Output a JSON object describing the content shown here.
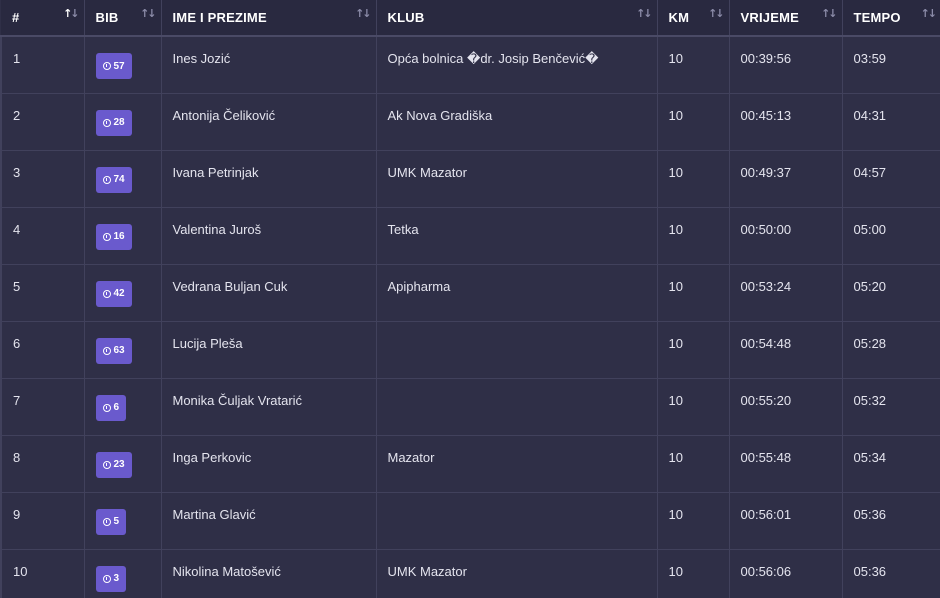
{
  "table": {
    "headers": [
      "#",
      "BIB",
      "IME I PREZIME",
      "KLUB",
      "KM",
      "VRIJEME",
      "TEMPO"
    ],
    "sort_icons": [
      "sort-asc-active-icon",
      "sort-icon",
      "sort-icon",
      "sort-icon",
      "sort-icon",
      "sort-icon",
      "sort-icon"
    ],
    "rows": [
      {
        "rank": "1",
        "bib": "57",
        "name": "Ines Jozić",
        "club": "Opća bolnica �dr. Josip Benčević�",
        "km": "10",
        "time": "00:39:56",
        "pace": "03:59"
      },
      {
        "rank": "2",
        "bib": "28",
        "name": "Antonija Čeliković",
        "club": "Ak Nova Gradiška",
        "km": "10",
        "time": "00:45:13",
        "pace": "04:31"
      },
      {
        "rank": "3",
        "bib": "74",
        "name": "Ivana Petrinjak",
        "club": "UMK Mazator",
        "km": "10",
        "time": "00:49:37",
        "pace": "04:57"
      },
      {
        "rank": "4",
        "bib": "16",
        "name": "Valentina Juroš",
        "club": "Tetka",
        "km": "10",
        "time": "00:50:00",
        "pace": "05:00"
      },
      {
        "rank": "5",
        "bib": "42",
        "name": "Vedrana Buljan Cuk",
        "club": "Apipharma",
        "km": "10",
        "time": "00:53:24",
        "pace": "05:20"
      },
      {
        "rank": "6",
        "bib": "63",
        "name": "Lucija Pleša",
        "club": "",
        "km": "10",
        "time": "00:54:48",
        "pace": "05:28"
      },
      {
        "rank": "7",
        "bib": "6",
        "name": "Monika Čuljak Vratarić",
        "club": "",
        "km": "10",
        "time": "00:55:20",
        "pace": "05:32"
      },
      {
        "rank": "8",
        "bib": "23",
        "name": "Inga Perkovic",
        "club": "Mazator",
        "km": "10",
        "time": "00:55:48",
        "pace": "05:34"
      },
      {
        "rank": "9",
        "bib": "5",
        "name": "Martina Glavić",
        "club": "",
        "km": "10",
        "time": "00:56:01",
        "pace": "05:36"
      },
      {
        "rank": "10",
        "bib": "3",
        "name": "Nikolina Matošević",
        "club": "UMK Mazator",
        "km": "10",
        "time": "00:56:06",
        "pace": "05:36"
      }
    ]
  },
  "colors": {
    "background": "#2f2f47",
    "header_bg": "#292940",
    "badge": "#6a5acd",
    "grid": "#41415c"
  }
}
